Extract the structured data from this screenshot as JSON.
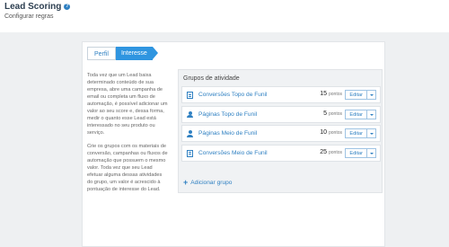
{
  "header": {
    "title": "Lead Scoring",
    "subtitle": "Configurar regras",
    "help_icon": "?"
  },
  "tabs": [
    {
      "label": "Perfil",
      "active": false
    },
    {
      "label": "Interesse",
      "active": true
    }
  ],
  "description": {
    "p1": "Toda vez que um Lead baixa determinado conteúdo de sua empresa, abre uma campanha de email ou completa um fluxo de automação, é possível adicionar um valor ao seu score e, dessa forma, medir o quanto esse Lead está interessado no seu produto ou serviço.",
    "p2": "Crie os grupos com os materiais de conversão, campanhas ou fluxos de automação que possuem o mesmo valor. Toda vez que seu Lead efetuar alguma dessas atividades do grupo, um valor é acrescido à pontuação de interesse do Lead."
  },
  "groups": {
    "title": "Grupos de atividade",
    "rows": [
      {
        "icon": "document-icon",
        "name": "Conversões Topo de Funil",
        "score": "15",
        "unit": "pontos",
        "edit_label": "Editar"
      },
      {
        "icon": "user-pin-icon",
        "name": "Páginas Topo de Funil",
        "score": "5",
        "unit": "pontos",
        "edit_label": "Editar"
      },
      {
        "icon": "user-pin-icon",
        "name": "Páginas Meio de Funil",
        "score": "10",
        "unit": "pontos",
        "edit_label": "Editar"
      },
      {
        "icon": "document-icon",
        "name": "Conversões Meio de Funil",
        "score": "25",
        "unit": "pontos",
        "edit_label": "Editar"
      }
    ],
    "add_label": "Adicionar grupo",
    "add_icon": "+"
  },
  "colors": {
    "accent": "#2f80c2",
    "active_tab": "#2f95e0",
    "background": "#eef0f2"
  }
}
